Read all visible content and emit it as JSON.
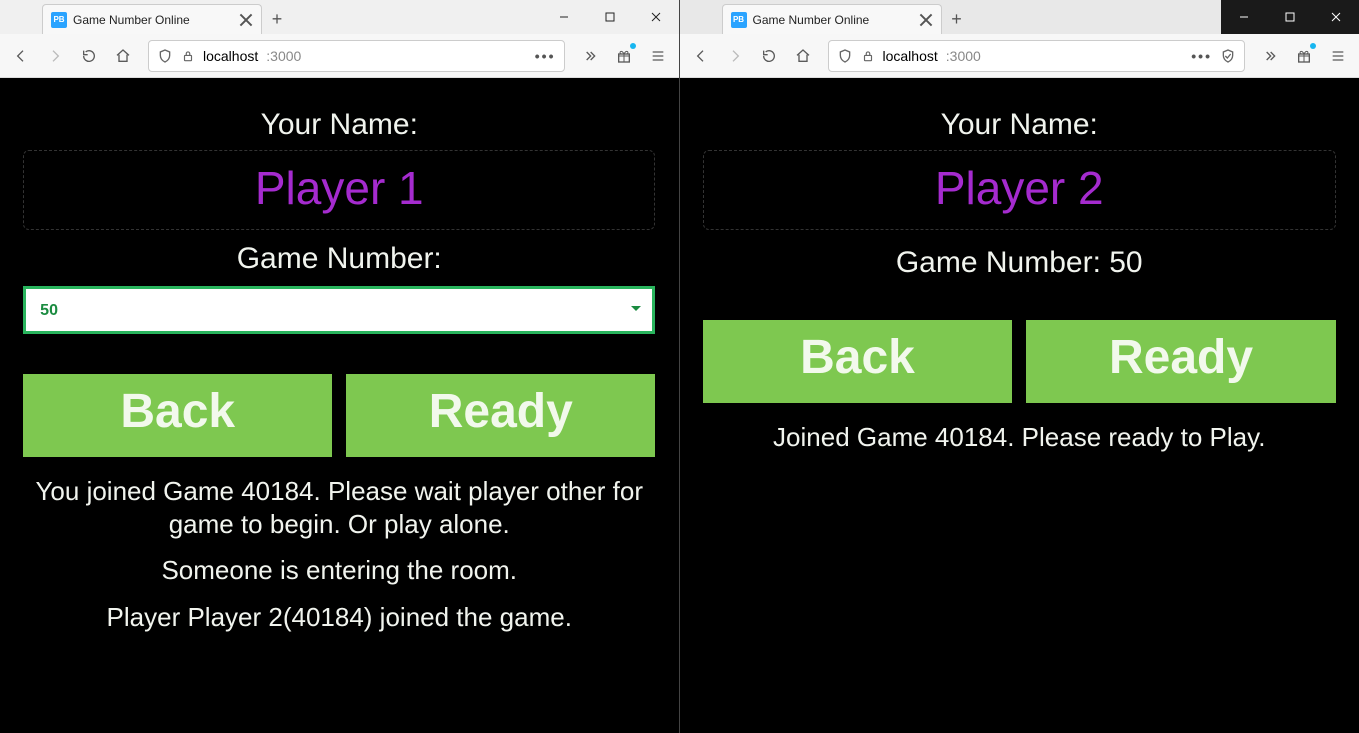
{
  "left": {
    "tab_title": "Game Number Online",
    "favicon_text": "PB",
    "url_host": "localhost",
    "url_port": ":3000",
    "name_label": "Your Name:",
    "name_value": "Player 1",
    "game_number_label": "Game Number:",
    "game_number_select_value": "50",
    "back_label": "Back",
    "ready_label": "Ready",
    "status_1": "You joined Game 40184. Please wait player other for game to begin. Or play alone.",
    "status_2": "Someone is entering the room.",
    "status_3": "Player Player 2(40184) joined the game."
  },
  "right": {
    "tab_title": "Game Number Online",
    "favicon_text": "PB",
    "url_host": "localhost",
    "url_port": ":3000",
    "name_label": "Your Name:",
    "name_value": "Player 2",
    "game_number_combined": "Game Number: 50",
    "back_label": "Back",
    "ready_label": "Ready",
    "status_1": "Joined Game 40184. Please ready to Play."
  }
}
